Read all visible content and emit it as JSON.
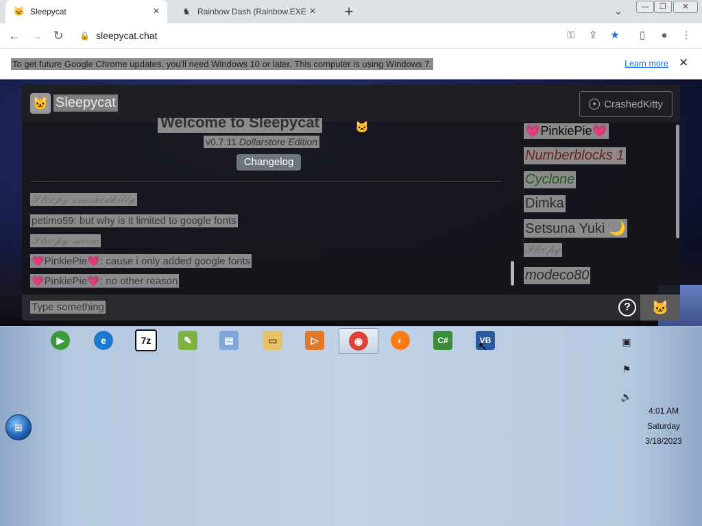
{
  "browser": {
    "tabs": [
      {
        "title": "Sleepycat",
        "favicon": "cat-icon",
        "active": true
      },
      {
        "title": "Rainbow Dash (Rainbow.EXE) | V",
        "favicon": "pony-icon",
        "active": false
      }
    ],
    "new_tab": "+",
    "url": "sleepycat.chat",
    "infobar": {
      "message": "To get future Google Chrome updates, you'll need Windows 10 or later. This computer is using Windows 7.",
      "link": "Learn more"
    }
  },
  "app": {
    "brand": "Sleepycat",
    "username": "CrashedKitty",
    "welcome": "Welcome to Sleepycat",
    "version": "v0.7.11",
    "edition": "Dollarstore Edition",
    "changelog_label": "Changelog",
    "messages": [
      {
        "text": "𝒮𝓁𝑒𝑒𝓅𝓎 𝒸𝓇𝒶𝓈𝒽𝑒𝒹𝓀𝒾𝓉𝓉𝓎",
        "style": "script"
      },
      {
        "text": "petimo59: but why is it limited to google fonts",
        "style": "plain"
      },
      {
        "text": "𝒮𝓁𝑒𝑒𝓅𝓎 𝓂𝑒𝑜𝓌",
        "style": "script"
      },
      {
        "text": "💗PinkiePie💗: cause i only added google fonts",
        "style": "plain"
      },
      {
        "text": "💗PinkiePie💗: no other reason",
        "style": "plain"
      }
    ],
    "users": [
      {
        "name": "💗PinkiePie💗",
        "color": "#2a2a2a",
        "italic": false
      },
      {
        "name": "Numberblocks 1",
        "color": "#6b1f1f",
        "italic": true
      },
      {
        "name": "Cyclone",
        "color": "#1f5a1f",
        "italic": true
      },
      {
        "name": "Dimka",
        "color": "#2a2a2a",
        "italic": false
      },
      {
        "name": "Setsuna Yuki 🌙",
        "color": "#2a2a2a",
        "italic": false
      },
      {
        "name": "𝒮𝓁𝑒𝑒𝓅𝓎",
        "color": "#6d6d6d",
        "italic": true
      },
      {
        "name": "modeco80",
        "color": "#2a2a2a",
        "italic": true
      }
    ],
    "input_placeholder": "Type something",
    "help_label": "?"
  },
  "taskbar": {
    "items": [
      {
        "name": "windows-media-player-icon",
        "glyph": "▶",
        "bg": "#3a9a3a"
      },
      {
        "name": "internet-explorer-icon",
        "glyph": "e",
        "bg": "#1e78d0"
      },
      {
        "name": "7zip-icon",
        "glyph": "7z",
        "bg": "#111111"
      },
      {
        "name": "paint-icon",
        "glyph": "✎",
        "bg": "#7cb342"
      },
      {
        "name": "document-icon",
        "glyph": "▤",
        "bg": "#7ea6d6"
      },
      {
        "name": "file-explorer-icon",
        "glyph": "▭",
        "bg": "#e8c066"
      },
      {
        "name": "media-player-icon",
        "glyph": "▷",
        "bg": "#e07a2a"
      },
      {
        "name": "chrome-icon",
        "glyph": "◉",
        "bg": "#db4437"
      },
      {
        "name": "firefox-icon",
        "glyph": "◐",
        "bg": "#ff7b16"
      },
      {
        "name": "csharp-icon",
        "glyph": "C#",
        "bg": "#3b8d3b"
      },
      {
        "name": "vb-icon",
        "glyph": "VB",
        "bg": "#2c5aa0"
      }
    ],
    "time": "4:01 AM",
    "day": "Saturday",
    "date": "3/18/2023"
  }
}
